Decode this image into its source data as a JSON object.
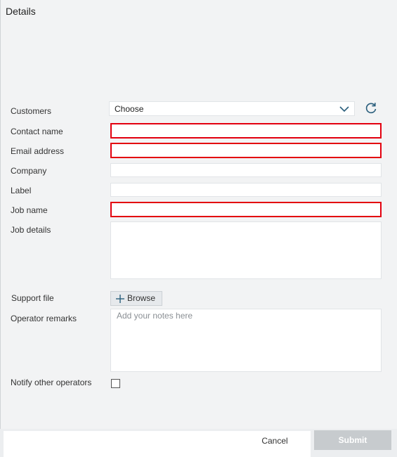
{
  "panel": {
    "title": "Details"
  },
  "colors": {
    "error_border": "#e3000f",
    "accent": "#2a5e7c",
    "submit_disabled": "#c7cbce"
  },
  "form": {
    "customers": {
      "label": "Customers",
      "selected": "Choose",
      "icon": "chevron-down-icon",
      "refresh_icon": "refresh-icon"
    },
    "contact_name": {
      "label": "Contact name",
      "value": "",
      "invalid": true
    },
    "email_address": {
      "label": "Email address",
      "value": "",
      "invalid": true
    },
    "company": {
      "label": "Company",
      "value": ""
    },
    "label_field": {
      "label": "Label",
      "value": ""
    },
    "job_name": {
      "label": "Job name",
      "value": "",
      "invalid": true
    },
    "job_details": {
      "label": "Job details",
      "value": ""
    },
    "support_file": {
      "label": "Support file",
      "button": "Browse",
      "icon": "plus-icon"
    },
    "operator_remarks": {
      "label": "Operator remarks",
      "placeholder": "Add your notes here"
    },
    "notify": {
      "label": "Notify other operators",
      "checked": false
    }
  },
  "footer": {
    "cancel": "Cancel",
    "submit": "Submit",
    "submit_enabled": false
  }
}
